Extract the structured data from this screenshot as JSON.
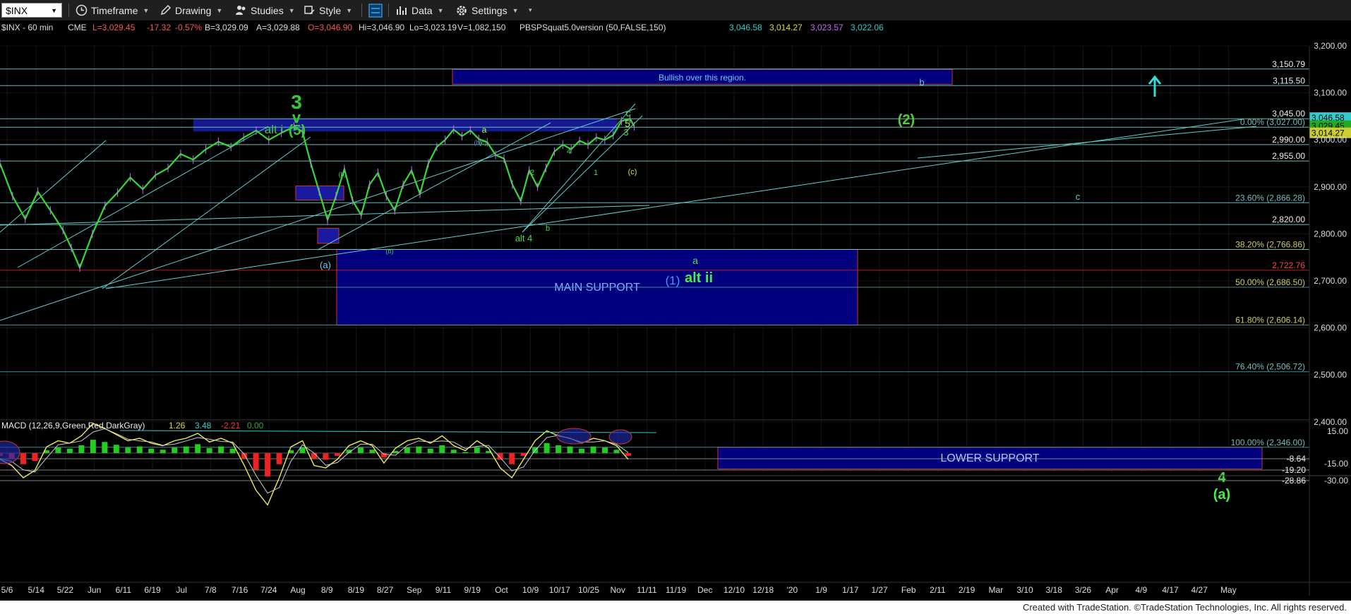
{
  "toolbar": {
    "symbol": "$INX",
    "timeframe": "Timeframe",
    "drawing": "Drawing",
    "studies": "Studies",
    "style": "Style",
    "data": "Data",
    "settings": "Settings"
  },
  "footer": {
    "credit": "Created with TradeStation. ©TradeStation Technologies, Inc. All rights reserved."
  },
  "colors": {
    "price_bars": "#33dd33",
    "fib_lines": "#66cccc",
    "zones": "#00008b",
    "bull_green": "#22cc22",
    "cyan_text": "#55cccc"
  },
  "chart_data": {
    "type": "line",
    "header": {
      "symbol_line": "$INX - 60 min",
      "exchange": "CME",
      "last": "L=3,029.45",
      "change": "-17.32",
      "change_pct": "-0.57%",
      "bid": "B=3,029.09",
      "ask": "A=3,029.88",
      "open": "O=3,046.90",
      "high": "Hi=3,046.90",
      "low": "Lo=3,023.19",
      "volume": "V=1,082,150",
      "study": "PBSPSquat5.0version (50,FALSE,150)",
      "study_values": [
        "3,046.58",
        "3,014.27",
        "3,023.57",
        "3,022.06"
      ]
    },
    "price_axis": {
      "ylim": [
        2300,
        3230
      ],
      "ticks": [
        "3,200.00",
        "3,100.00",
        "3,000.00",
        "2,900.00",
        "2,800.00",
        "2,700.00",
        "2,600.00",
        "2,500.00",
        "2,400.00"
      ]
    },
    "x_axis": {
      "labels": [
        "5/6",
        "5/14",
        "5/22",
        "Jun",
        "6/11",
        "6/19",
        "Jul",
        "7/8",
        "7/16",
        "7/24",
        "Aug",
        "8/9",
        "8/19",
        "8/27",
        "Sep",
        "9/11",
        "9/19",
        "Oct",
        "10/9",
        "10/17",
        "10/25",
        "Nov",
        "11/11",
        "11/19",
        "Dec",
        "12/10",
        "12/18",
        "'20",
        "1/9",
        "1/17",
        "1/27",
        "Feb",
        "2/11",
        "2/19",
        "Mar",
        "3/10",
        "3/18",
        "3/26",
        "Apr",
        "4/9",
        "4/17",
        "4/27",
        "May"
      ]
    },
    "horizontal_levels": [
      {
        "value": 3150.79,
        "label": "3,150.79"
      },
      {
        "value": 3115.5,
        "label": "3,115.50"
      },
      {
        "value": 3045.0,
        "label": "3,045.00"
      },
      {
        "value": 3027.0,
        "label": "0.00% (3,027.00)"
      },
      {
        "value": 2990.0,
        "label": "2,990.00"
      },
      {
        "value": 2955.0,
        "label": "2,955.00"
      },
      {
        "value": 2866.28,
        "label": "23.60% (2,866.28)"
      },
      {
        "value": 2820.0,
        "label": "2,820.00"
      },
      {
        "value": 2766.86,
        "label": "38.20% (2,766.86)"
      },
      {
        "value": 2722.76,
        "label": "2,722.76",
        "color": "red"
      },
      {
        "value": 2686.5,
        "label": "50.00% (2,686.50)"
      },
      {
        "value": 2606.14,
        "label": "61.80% (2,606.14)"
      },
      {
        "value": 2506.72,
        "label": "76.40% (2,506.72)"
      },
      {
        "value": 2346.0,
        "label": "100.00% (2,346.00)"
      }
    ],
    "price_tags": [
      {
        "value": 3046.58,
        "label": "3,046.58",
        "color": "#33cccc"
      },
      {
        "value": 3029.45,
        "label": "3,029.45",
        "color": "#22aa22"
      },
      {
        "value": 3014.27,
        "label": "3,014.27",
        "color": "#cccc33"
      }
    ],
    "zones": [
      {
        "label": "Bullish over this region.",
        "from": 3118,
        "to": 3150
      },
      {
        "label": "MAIN SUPPORT",
        "from": 2606,
        "to": 2767
      },
      {
        "label": "LOWER SUPPORT",
        "from": 2300,
        "to": 2346
      }
    ],
    "wave_labels": [
      "3",
      "v",
      "(5)",
      "alt i",
      "a",
      "(c)",
      "(a)",
      "(b)",
      "(b)",
      "c",
      "5",
      "3",
      "4",
      "1",
      "2",
      "b",
      "alt 4",
      "(c)",
      "a",
      "alt ii",
      "(1)",
      "b",
      "(2)",
      "c",
      "4",
      "(a)",
      "(b)"
    ],
    "price_series": [
      {
        "d": 0,
        "v": 2950
      },
      {
        "d": 3,
        "v": 2880
      },
      {
        "d": 6,
        "v": 2832
      },
      {
        "d": 9,
        "v": 2890
      },
      {
        "d": 12,
        "v": 2850
      },
      {
        "d": 15,
        "v": 2808
      },
      {
        "d": 17,
        "v": 2770
      },
      {
        "d": 19,
        "v": 2728
      },
      {
        "d": 22,
        "v": 2800
      },
      {
        "d": 25,
        "v": 2860
      },
      {
        "d": 28,
        "v": 2888
      },
      {
        "d": 31,
        "v": 2920
      },
      {
        "d": 34,
        "v": 2895
      },
      {
        "d": 37,
        "v": 2925
      },
      {
        "d": 40,
        "v": 2940
      },
      {
        "d": 43,
        "v": 2970
      },
      {
        "d": 46,
        "v": 2958
      },
      {
        "d": 49,
        "v": 2980
      },
      {
        "d": 52,
        "v": 2996
      },
      {
        "d": 55,
        "v": 2985
      },
      {
        "d": 58,
        "v": 3005
      },
      {
        "d": 61,
        "v": 3020
      },
      {
        "d": 64,
        "v": 3000
      },
      {
        "d": 67,
        "v": 3015
      },
      {
        "d": 70,
        "v": 3028
      },
      {
        "d": 72,
        "v": 3018
      },
      {
        "d": 74,
        "v": 2950
      },
      {
        "d": 76,
        "v": 2890
      },
      {
        "d": 78,
        "v": 2830
      },
      {
        "d": 80,
        "v": 2880
      },
      {
        "d": 82,
        "v": 2938
      },
      {
        "d": 84,
        "v": 2870
      },
      {
        "d": 86,
        "v": 2840
      },
      {
        "d": 88,
        "v": 2905
      },
      {
        "d": 90,
        "v": 2930
      },
      {
        "d": 92,
        "v": 2880
      },
      {
        "d": 94,
        "v": 2850
      },
      {
        "d": 96,
        "v": 2905
      },
      {
        "d": 98,
        "v": 2935
      },
      {
        "d": 100,
        "v": 2885
      },
      {
        "d": 102,
        "v": 2950
      },
      {
        "d": 104,
        "v": 2985
      },
      {
        "d": 106,
        "v": 3000
      },
      {
        "d": 108,
        "v": 3022
      },
      {
        "d": 110,
        "v": 3008
      },
      {
        "d": 112,
        "v": 3020
      },
      {
        "d": 114,
        "v": 3002
      },
      {
        "d": 116,
        "v": 2995
      },
      {
        "d": 118,
        "v": 2968
      },
      {
        "d": 120,
        "v": 2960
      },
      {
        "d": 122,
        "v": 2905
      },
      {
        "d": 124,
        "v": 2870
      },
      {
        "d": 126,
        "v": 2935
      },
      {
        "d": 128,
        "v": 2900
      },
      {
        "d": 130,
        "v": 2940
      },
      {
        "d": 132,
        "v": 2975
      },
      {
        "d": 134,
        "v": 2990
      },
      {
        "d": 136,
        "v": 2980
      },
      {
        "d": 138,
        "v": 2998
      },
      {
        "d": 140,
        "v": 2990
      },
      {
        "d": 142,
        "v": 3005
      },
      {
        "d": 144,
        "v": 3000
      },
      {
        "d": 146,
        "v": 3010
      },
      {
        "d": 148,
        "v": 3040
      },
      {
        "d": 150,
        "v": 3045
      },
      {
        "d": 151,
        "v": 3029
      }
    ],
    "macd": {
      "label": "MACD (12,26,9,Green,Red,DarkGray)",
      "values": [
        "1.26",
        "3.48",
        "-2.21",
        "0.00"
      ],
      "ticks": [
        "15.00",
        "-15.00",
        "-30.00"
      ],
      "levels": [
        "-8.64",
        "-19.20",
        "-28.86"
      ],
      "series": [
        -5,
        -10,
        -20,
        -14,
        5,
        10,
        8,
        14,
        24,
        20,
        15,
        10,
        12,
        8,
        6,
        10,
        12,
        16,
        9,
        12,
        8,
        -10,
        -30,
        -42,
        -20,
        5,
        10,
        -10,
        -12,
        -5,
        6,
        10,
        6,
        -8,
        4,
        10,
        12,
        8,
        14,
        6,
        2,
        10,
        4,
        -12,
        -20,
        -5,
        10,
        18,
        14,
        12,
        8,
        12,
        10,
        6,
        -5
      ]
    }
  }
}
